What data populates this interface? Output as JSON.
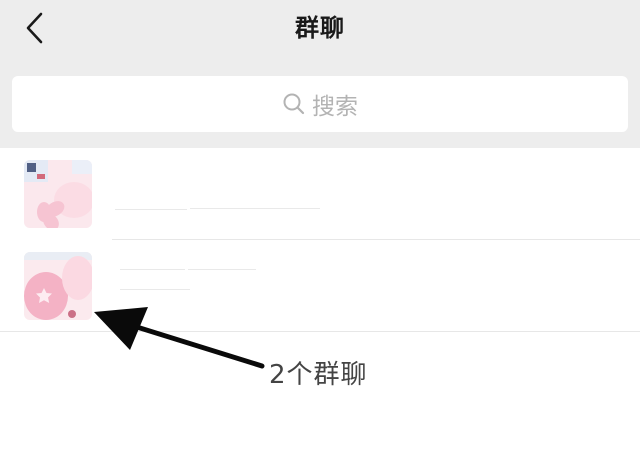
{
  "header": {
    "title": "群聊",
    "back_icon": "chevron-left-icon"
  },
  "search": {
    "label": "搜索",
    "icon": "search-icon"
  },
  "group_list": [
    {
      "avatar": "group-avatar-1"
    },
    {
      "avatar": "group-avatar-2"
    }
  ],
  "footer": {
    "count_text": "2个群聊"
  },
  "colors": {
    "header_bg": "#ededed",
    "search_bg": "#ffffff",
    "avatar_pink": "#f2a5bb",
    "annotation": "#0a0a0a"
  }
}
